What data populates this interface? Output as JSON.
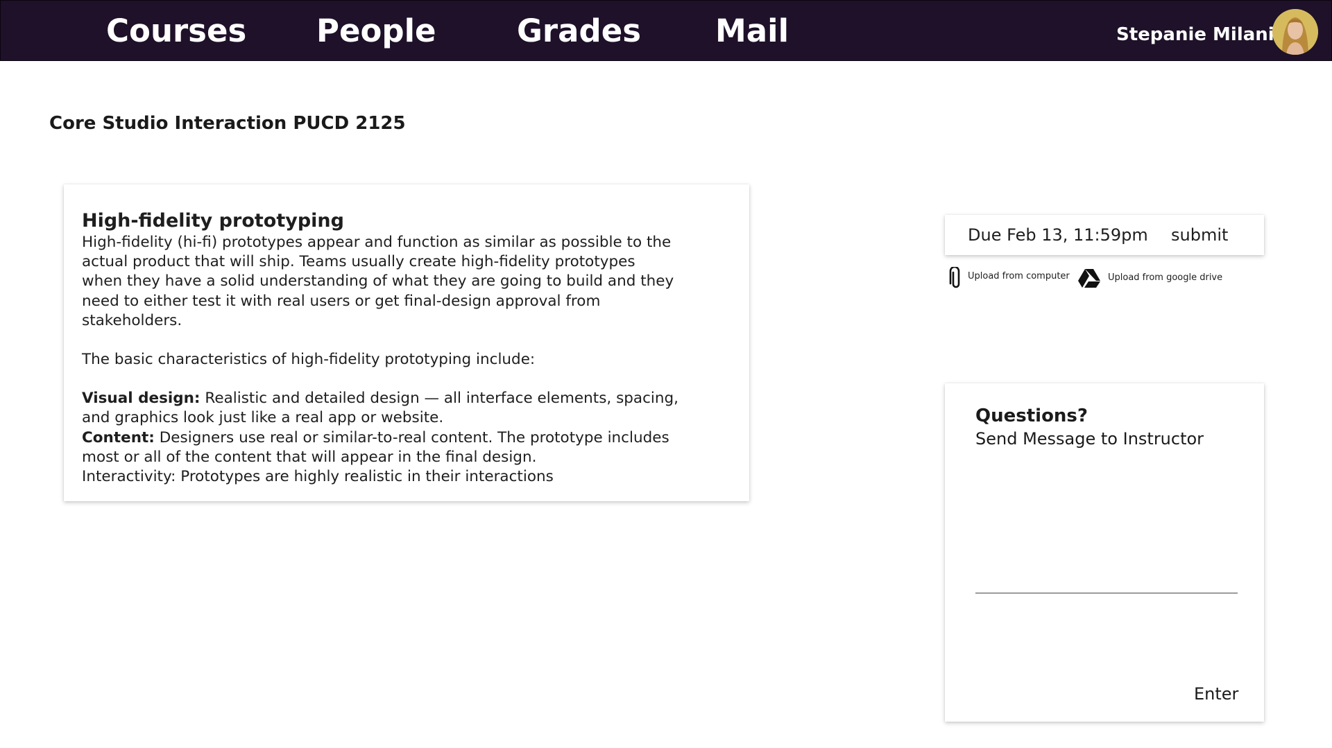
{
  "nav": {
    "items": [
      {
        "label": "Courses"
      },
      {
        "label": "People"
      },
      {
        "label": "Grades"
      },
      {
        "label": "Mail"
      }
    ],
    "user_name": "Stepanie Milani",
    "avatar_icon": "user-avatar-photo"
  },
  "page": {
    "title": "Core Studio Interaction PUCD 2125"
  },
  "content": {
    "heading": "High-fidelity prototyping",
    "intro": "High-fidelity (hi-fi) prototypes appear and function as similar as possible to the actual product that will ship. Teams usually create high-fidelity prototypes when they have a solid understanding of what they are going to build and they need to either test it with real users or get final-design approval from stakeholders.",
    "characteristics_intro": "The basic characteristics of high-fidelity prototyping include:",
    "visual_design_label": "Visual design:",
    "visual_design_text": " Realistic and detailed design — all interface elements, spacing, and graphics look just like a real app or website.",
    "content_label": "Content:",
    "content_text": " Designers use real or similar-to-real content. The prototype includes most or all of the content that will appear in the final design.",
    "interactivity_text": "Interactivity: Prototypes are highly realistic in their interactions"
  },
  "assignment": {
    "due": "Due Feb 13, 11:59pm",
    "submit_label": "submit",
    "upload_computer_label": "Upload from computer",
    "upload_computer_icon": "paperclip-icon",
    "upload_drive_label": "Upload from google drive",
    "upload_drive_icon": "google-drive-icon"
  },
  "questions": {
    "title": "Questions?",
    "subtitle": "Send Message to Instructor",
    "input_value": "",
    "enter_label": "Enter"
  },
  "colors": {
    "topbar": "#1e1129",
    "text": "#1e1e1e",
    "background": "#ffffff"
  }
}
